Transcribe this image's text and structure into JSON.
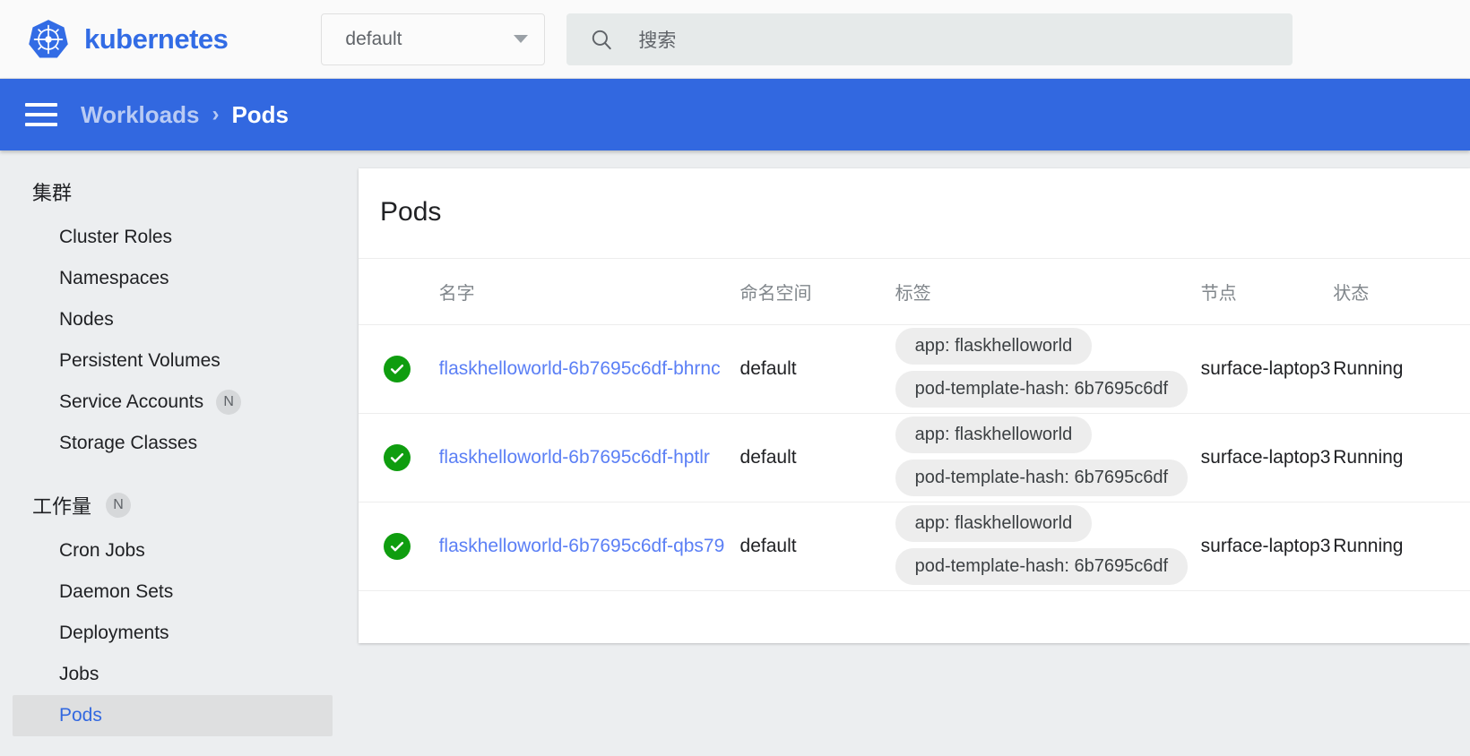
{
  "header": {
    "brand_name": "kubernetes",
    "logo_icon": "kubernetes-helm-wheel-icon",
    "namespace_select": {
      "value": "default",
      "caret_icon": "chevron-down-icon"
    },
    "search": {
      "placeholder": "搜索",
      "icon": "search-icon"
    }
  },
  "breadcrumb": {
    "menu_icon": "hamburger-menu-icon",
    "parent": "Workloads",
    "separator": "›",
    "current": "Pods"
  },
  "sidebar": {
    "groups": [
      {
        "title": "集群",
        "badge": "",
        "items": [
          {
            "label": "Cluster Roles",
            "badge": "",
            "selected": false
          },
          {
            "label": "Namespaces",
            "badge": "",
            "selected": false
          },
          {
            "label": "Nodes",
            "badge": "",
            "selected": false
          },
          {
            "label": "Persistent Volumes",
            "badge": "",
            "selected": false
          },
          {
            "label": "Service Accounts",
            "badge": "N",
            "selected": false
          },
          {
            "label": "Storage Classes",
            "badge": "",
            "selected": false
          }
        ]
      },
      {
        "title": "工作量",
        "badge": "N",
        "items": [
          {
            "label": "Cron Jobs",
            "badge": "",
            "selected": false
          },
          {
            "label": "Daemon Sets",
            "badge": "",
            "selected": false
          },
          {
            "label": "Deployments",
            "badge": "",
            "selected": false
          },
          {
            "label": "Jobs",
            "badge": "",
            "selected": false
          },
          {
            "label": "Pods",
            "badge": "",
            "selected": true
          }
        ]
      }
    ]
  },
  "main": {
    "card_title": "Pods",
    "columns": [
      "",
      "名字",
      "命名空间",
      "标签",
      "节点",
      "状态"
    ],
    "rows": [
      {
        "status_icon": "check-circle-icon",
        "name": "flaskhelloworld-6b7695c6df-bhrnc",
        "namespace": "default",
        "labels": [
          "app: flaskhelloworld",
          "pod-template-hash: 6b7695c6df"
        ],
        "node": "surface-laptop3",
        "status": "Running"
      },
      {
        "status_icon": "check-circle-icon",
        "name": "flaskhelloworld-6b7695c6df-hptlr",
        "namespace": "default",
        "labels": [
          "app: flaskhelloworld",
          "pod-template-hash: 6b7695c6df"
        ],
        "node": "surface-laptop3",
        "status": "Running"
      },
      {
        "status_icon": "check-circle-icon",
        "name": "flaskhelloworld-6b7695c6df-qbs79",
        "namespace": "default",
        "labels": [
          "app: flaskhelloworld",
          "pod-template-hash: 6b7695c6df"
        ],
        "node": "surface-laptop3",
        "status": "Running"
      }
    ]
  },
  "colors": {
    "brand_blue": "#326ce5",
    "bar_blue": "#3268e0",
    "link_blue": "#5b7ff5",
    "status_green": "#0f9d0f",
    "page_bg": "#eceef0",
    "chip_bg": "#ededed"
  }
}
